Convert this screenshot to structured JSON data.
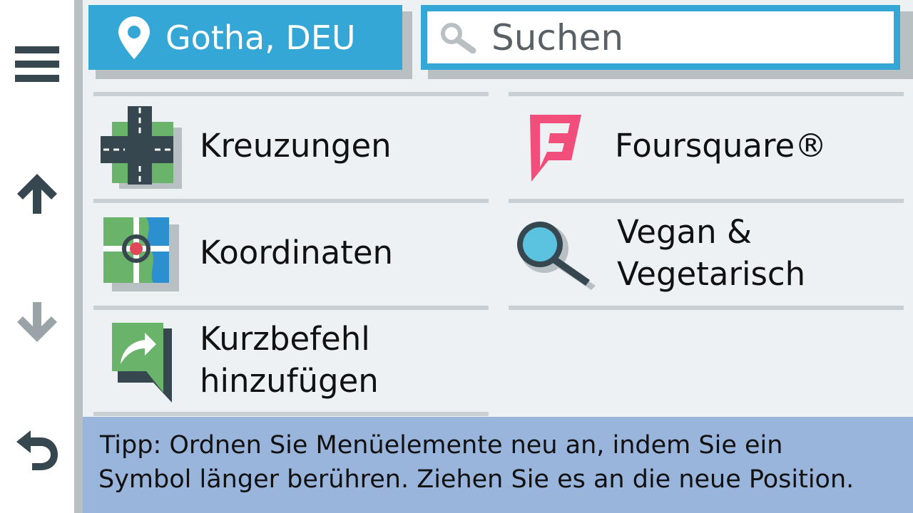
{
  "header": {
    "location_label": "Gotha, DEU",
    "search_placeholder": "Suchen"
  },
  "rail": {
    "menu_icon": "hamburger-menu-icon",
    "up_icon": "arrow-up-icon",
    "down_icon": "arrow-down-icon",
    "back_icon": "back-icon"
  },
  "items": [
    {
      "line1": "Kreuzungen",
      "line2": "",
      "icon": "intersection-icon"
    },
    {
      "line1": "Foursquare®",
      "line2": "",
      "icon": "foursquare-icon"
    },
    {
      "line1": "Koordinaten",
      "line2": "",
      "icon": "coordinates-map-icon"
    },
    {
      "line1": "Vegan &",
      "line2": "Vegetarisch",
      "icon": "magnifier-search-icon"
    },
    {
      "line1": "Kurzbefehl",
      "line2": "hinzufügen",
      "icon": "add-shortcut-icon"
    }
  ],
  "tip": {
    "line1": "Tipp: Ordnen Sie Menüelemente neu an, indem Sie ein",
    "line2": "Symbol länger berühren. Ziehen Sie es an die neue Position."
  },
  "colors": {
    "accent": "#35a7d6",
    "background": "#edf1f4",
    "tip_background": "#99b5dc",
    "foursquare": "#f24e7b"
  }
}
